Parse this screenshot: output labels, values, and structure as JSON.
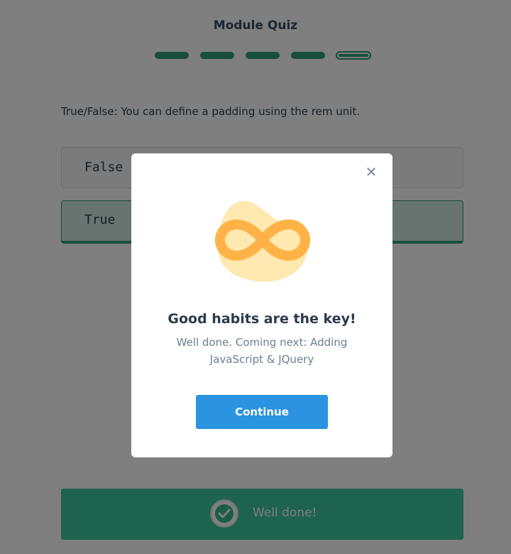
{
  "header": {
    "title": "Module Quiz"
  },
  "progress": {
    "total_segments": 5,
    "current_segment": 5
  },
  "quiz": {
    "question": "True/False: You can define a padding using the rem unit.",
    "options": [
      {
        "label": "False",
        "selected": false
      },
      {
        "label": "True",
        "selected": true
      }
    ]
  },
  "result_bar": {
    "text": "Well done!",
    "icon": "check-icon"
  },
  "modal": {
    "close_icon": "close-icon",
    "illustration": "infinity-icon",
    "title": "Good habits are the key!",
    "subtitle": "Well done. Coming next: Adding JavaScript & JQuery",
    "continue_label": "Continue"
  },
  "colors": {
    "accent_green": "#2e9e78",
    "button_blue": "#2b94e0",
    "illustration_orange": "#ffb347",
    "illustration_blob": "#ffe9b0"
  }
}
